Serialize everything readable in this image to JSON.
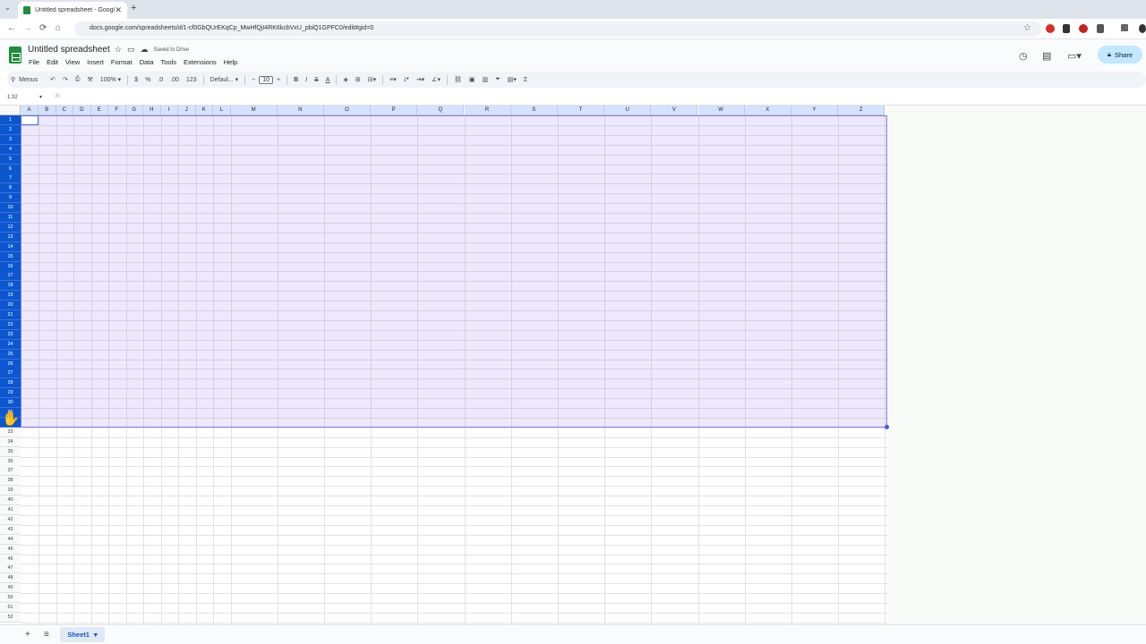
{
  "browser": {
    "tab_title": "Untitled spreadsheet - Google",
    "tab_close": "✕",
    "new_tab": "+",
    "url": "docs.google.com/spreadsheets/d/1-cf0GbQUrEKqCp_MwHfQjI4RK6kcbVxU_pbiQ1GPFC0/edit#gid=0",
    "back": "←",
    "forward": "→",
    "reload": "⟳",
    "home": "⌂",
    "bookmark": "☆"
  },
  "app": {
    "doc_title": "Untitled spreadsheet",
    "saved_status": "Saved to Drive",
    "menus": [
      "File",
      "Edit",
      "View",
      "Insert",
      "Format",
      "Data",
      "Tools",
      "Extensions",
      "Help"
    ],
    "share_label": "Share"
  },
  "toolbar": {
    "menus_label": "Menus",
    "zoom": "100%",
    "currency": "$",
    "percent": "%",
    "dec_decrease": ".0",
    "dec_increase": ".00",
    "format_123": "123",
    "font": "Defaul...",
    "font_size": "10",
    "bold": "B",
    "italic": "I",
    "strike": "S",
    "text_color": "A",
    "sum": "Σ"
  },
  "formula_bar": {
    "name_box": "1:32",
    "fx": "fx"
  },
  "grid": {
    "columns": [
      "A",
      "B",
      "C",
      "D",
      "E",
      "F",
      "G",
      "H",
      "I",
      "J",
      "K",
      "L",
      "M",
      "N",
      "O",
      "P",
      "Q",
      "R",
      "S",
      "T",
      "U",
      "V",
      "W",
      "X",
      "Y",
      "Z"
    ],
    "rows_visible": 52,
    "selected_rows": "1-32"
  },
  "sheets": {
    "add": "+",
    "all": "≡",
    "active_tab": "Sheet1"
  }
}
